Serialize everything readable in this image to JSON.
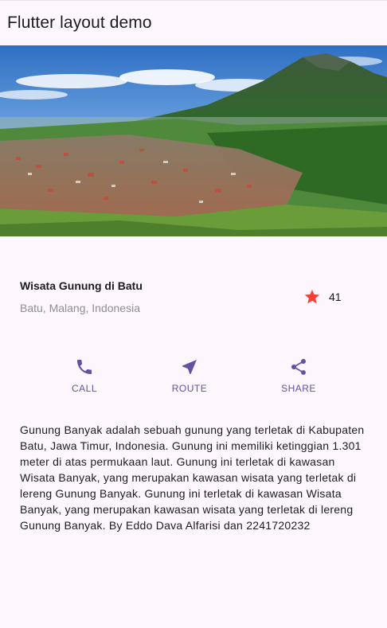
{
  "appbar": {
    "title": "Flutter layout demo"
  },
  "hero": {
    "image_icon": "mountain-landscape-photo"
  },
  "title_section": {
    "name": "Wisata Gunung di Batu",
    "location": "Batu, Malang, Indonesia",
    "rating_icon": "star-icon",
    "rating_count": "41"
  },
  "actions": [
    {
      "label": "CALL",
      "icon": "phone-icon"
    },
    {
      "label": "ROUTE",
      "icon": "navigation-icon"
    },
    {
      "label": "SHARE",
      "icon": "share-icon"
    }
  ],
  "description": "Gunung Banyak adalah sebuah gunung yang terletak di Kabupaten Batu, Jawa Timur, Indonesia. Gunung ini memiliki ketinggian 1.301 meter di atas permukaan laut. Gunung ini terletak di kawasan Wisata Banyak, yang merupakan kawasan wisata yang terletak di lereng Gunung Banyak. Gunung ini terletak di kawasan Wisata Banyak, yang merupakan kawasan wisata yang terletak di lereng Gunung Banyak. By Eddo Dava Alfarisi dan 2241720232",
  "colors": {
    "primary": "#6750a4",
    "star": "#f44336",
    "background": "#fdf7fd",
    "subtitle": "#8f8f8f"
  }
}
